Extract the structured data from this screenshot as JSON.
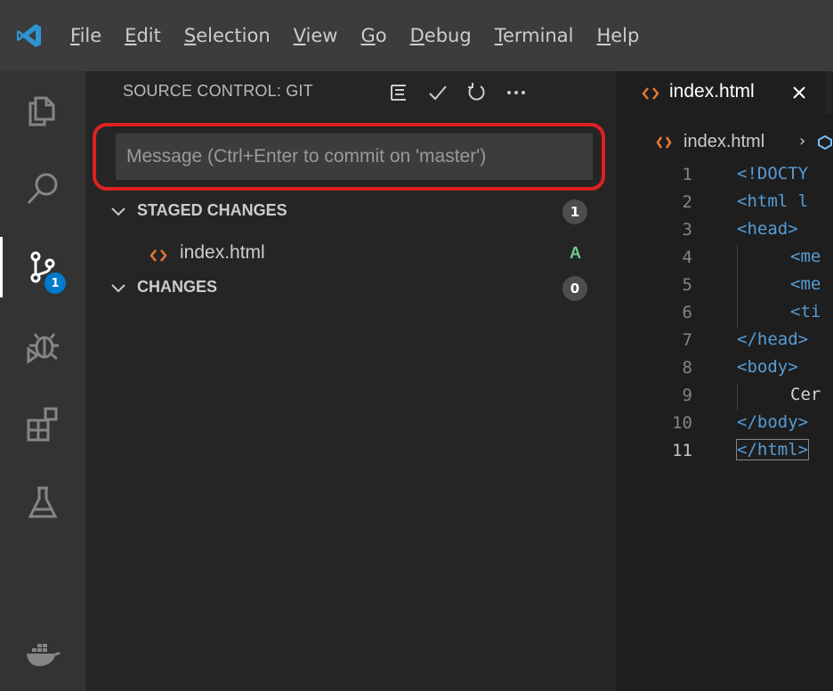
{
  "menu": {
    "items": [
      {
        "mnemonic": "F",
        "rest": "ile"
      },
      {
        "mnemonic": "E",
        "rest": "dit"
      },
      {
        "mnemonic": "S",
        "rest": "election"
      },
      {
        "mnemonic": "V",
        "rest": "iew"
      },
      {
        "mnemonic": "G",
        "rest": "o"
      },
      {
        "mnemonic": "D",
        "rest": "ebug"
      },
      {
        "mnemonic": "T",
        "rest": "erminal"
      },
      {
        "mnemonic": "H",
        "rest": "elp"
      }
    ]
  },
  "activity_bar": {
    "items": [
      "explorer-icon",
      "search-icon",
      "source-control-icon",
      "debug-icon",
      "extensions-icon",
      "testing-icon",
      "docker-icon"
    ],
    "scm_badge": "1"
  },
  "sidebar": {
    "title": "SOURCE CONTROL: GIT",
    "actions": [
      "view-as-tree-icon",
      "commit-check-icon",
      "refresh-icon",
      "more-actions-icon"
    ],
    "commit_message": {
      "value": "",
      "placeholder": "Message (Ctrl+Enter to commit on 'master')"
    },
    "staged": {
      "label": "STAGED CHANGES",
      "count": "1",
      "files": [
        {
          "name": "index.html",
          "status": "A"
        }
      ]
    },
    "changes": {
      "label": "CHANGES",
      "count": "0"
    }
  },
  "editor": {
    "tab": {
      "label": "index.html",
      "close": "×"
    },
    "breadcrumb": {
      "file": "index.html",
      "separator": "›"
    },
    "lines": [
      {
        "n": "1",
        "text": "<!DOCTY"
      },
      {
        "n": "2",
        "text": "<html l"
      },
      {
        "n": "3",
        "text": "<head>"
      },
      {
        "n": "4",
        "text": "<me"
      },
      {
        "n": "5",
        "text": "<me"
      },
      {
        "n": "6",
        "text": "<ti"
      },
      {
        "n": "7",
        "text": "</head>"
      },
      {
        "n": "8",
        "text": "<body>"
      },
      {
        "n": "9",
        "text": "Cer"
      },
      {
        "n": "10",
        "text": "</body>"
      },
      {
        "n": "11",
        "text": "</html>"
      }
    ]
  },
  "colors": {
    "accent": "#007acc",
    "highlight": "#e02020",
    "added": "#73c991",
    "html_icon": "#e37933",
    "tag": "#569cd6"
  }
}
